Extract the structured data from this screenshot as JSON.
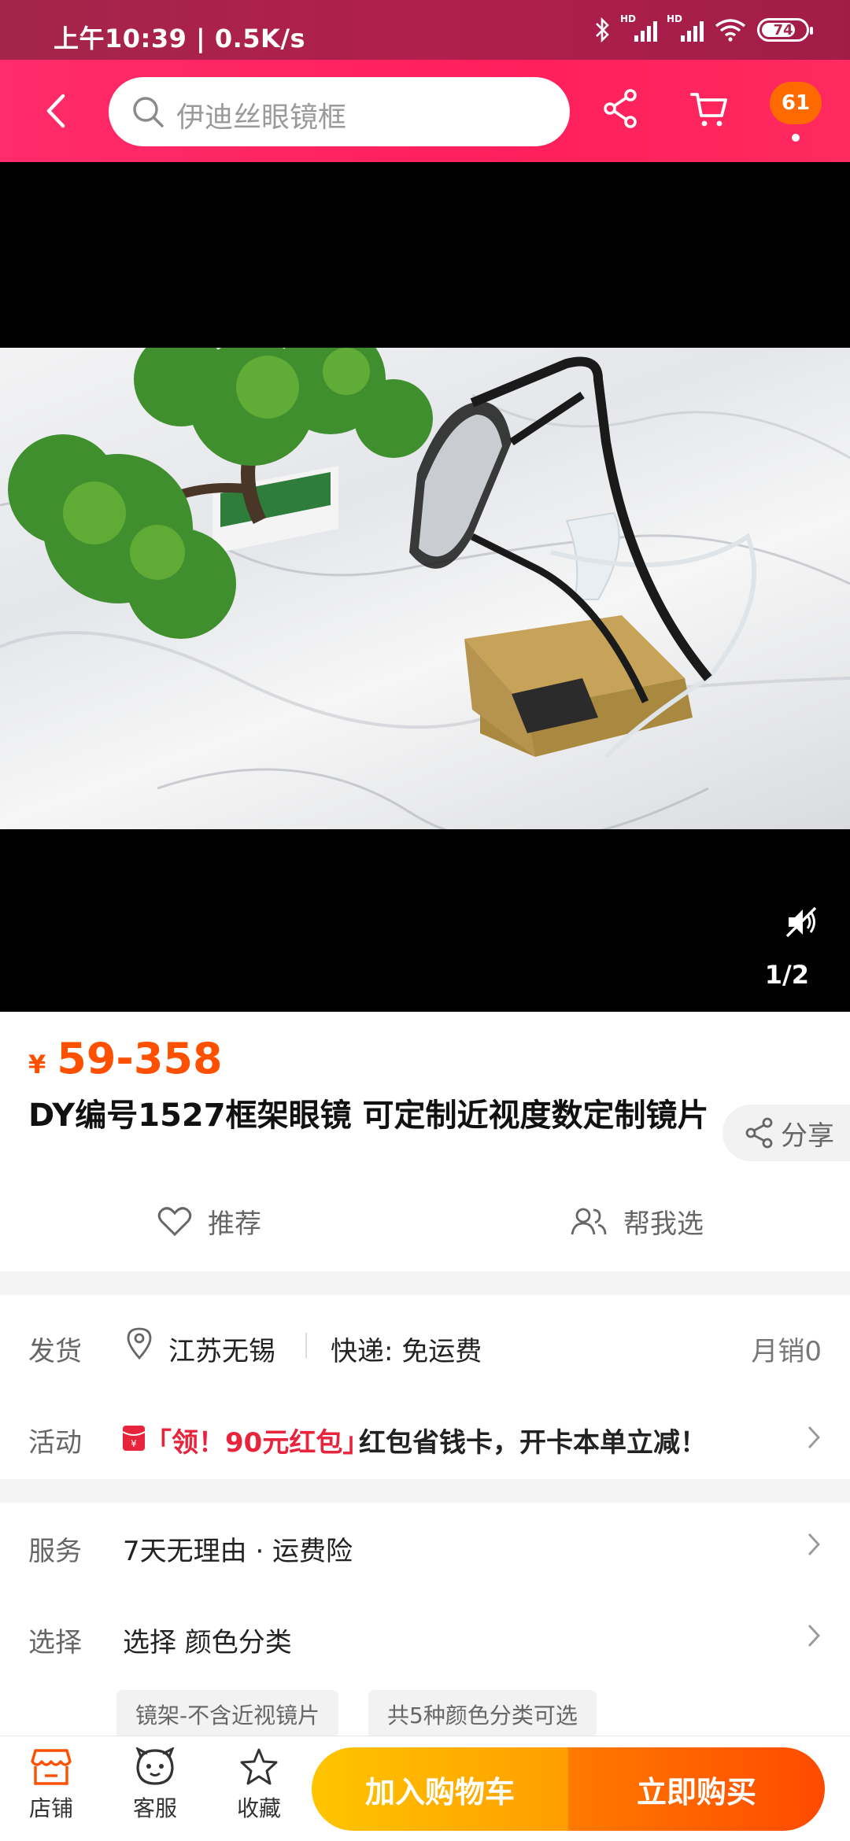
{
  "status_bar": {
    "time_speed": "上午10:39 | 0.5K/s",
    "battery": "74",
    "hd": "HD"
  },
  "header": {
    "search_placeholder": "伊迪丝眼镜框",
    "badge_count": "61"
  },
  "media": {
    "counter": "1/2"
  },
  "product": {
    "currency": "¥",
    "price": "59-358",
    "title": "DY编号1527框架眼镜 可定制近视度数定制镜片",
    "share_label": "分享",
    "recommend_label": "推荐",
    "help_choose_label": "帮我选"
  },
  "shipping": {
    "label": "发货",
    "location": "江苏无锡",
    "express": "快递: 免运费",
    "monthly_sales": "月销0"
  },
  "activity": {
    "label": "活动",
    "highlight": "「领！90元红包」",
    "text": "红包省钱卡，开卡本单立减！",
    "accent_color": "#e8243c"
  },
  "service": {
    "label": "服务",
    "text": "7天无理由 · 运费险"
  },
  "select": {
    "label": "选择",
    "text": "选择 颜色分类",
    "chips": [
      "镜架-不含近视镜片",
      "共5种颜色分类可选"
    ]
  },
  "bottom_bar": {
    "shop": "店铺",
    "service": "客服",
    "favorite": "收藏",
    "add_to_cart": "加入购物车",
    "buy_now": "立即购买"
  },
  "colors": {
    "brand": "#ff2b6a",
    "price": "#ff5000",
    "cart_btn": "#ffb000",
    "buy_btn": "#ff5a00"
  }
}
